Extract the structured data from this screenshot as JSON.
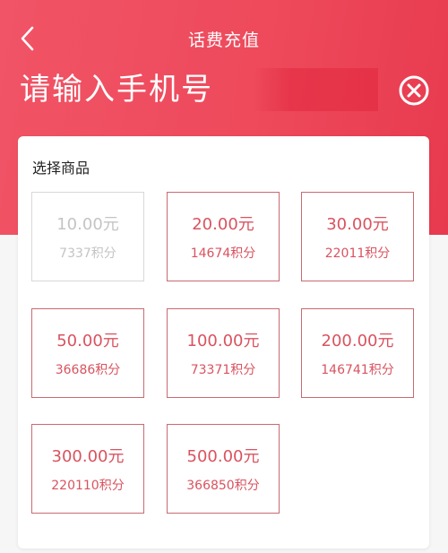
{
  "header": {
    "title": "话费充值",
    "phone_placeholder": "请输入手机号"
  },
  "icons": {
    "back": "chevron-left-icon",
    "clear": "circle-x-icon"
  },
  "colors": {
    "header_bg": "#ee4a5c",
    "accent": "#d9535f",
    "border": "#c96a70",
    "disabled": "#c4c4c4"
  },
  "products": {
    "title": "选择商品",
    "options": [
      {
        "price": "10.00元",
        "points": "7337积分",
        "disabled": true
      },
      {
        "price": "20.00元",
        "points": "14674积分",
        "disabled": false
      },
      {
        "price": "30.00元",
        "points": "22011积分",
        "disabled": false
      },
      {
        "price": "50.00元",
        "points": "36686积分",
        "disabled": false
      },
      {
        "price": "100.00元",
        "points": "73371积分",
        "disabled": false
      },
      {
        "price": "200.00元",
        "points": "146741积分",
        "disabled": false
      },
      {
        "price": "300.00元",
        "points": "220110积分",
        "disabled": false
      },
      {
        "price": "500.00元",
        "points": "366850积分",
        "disabled": false
      }
    ]
  }
}
